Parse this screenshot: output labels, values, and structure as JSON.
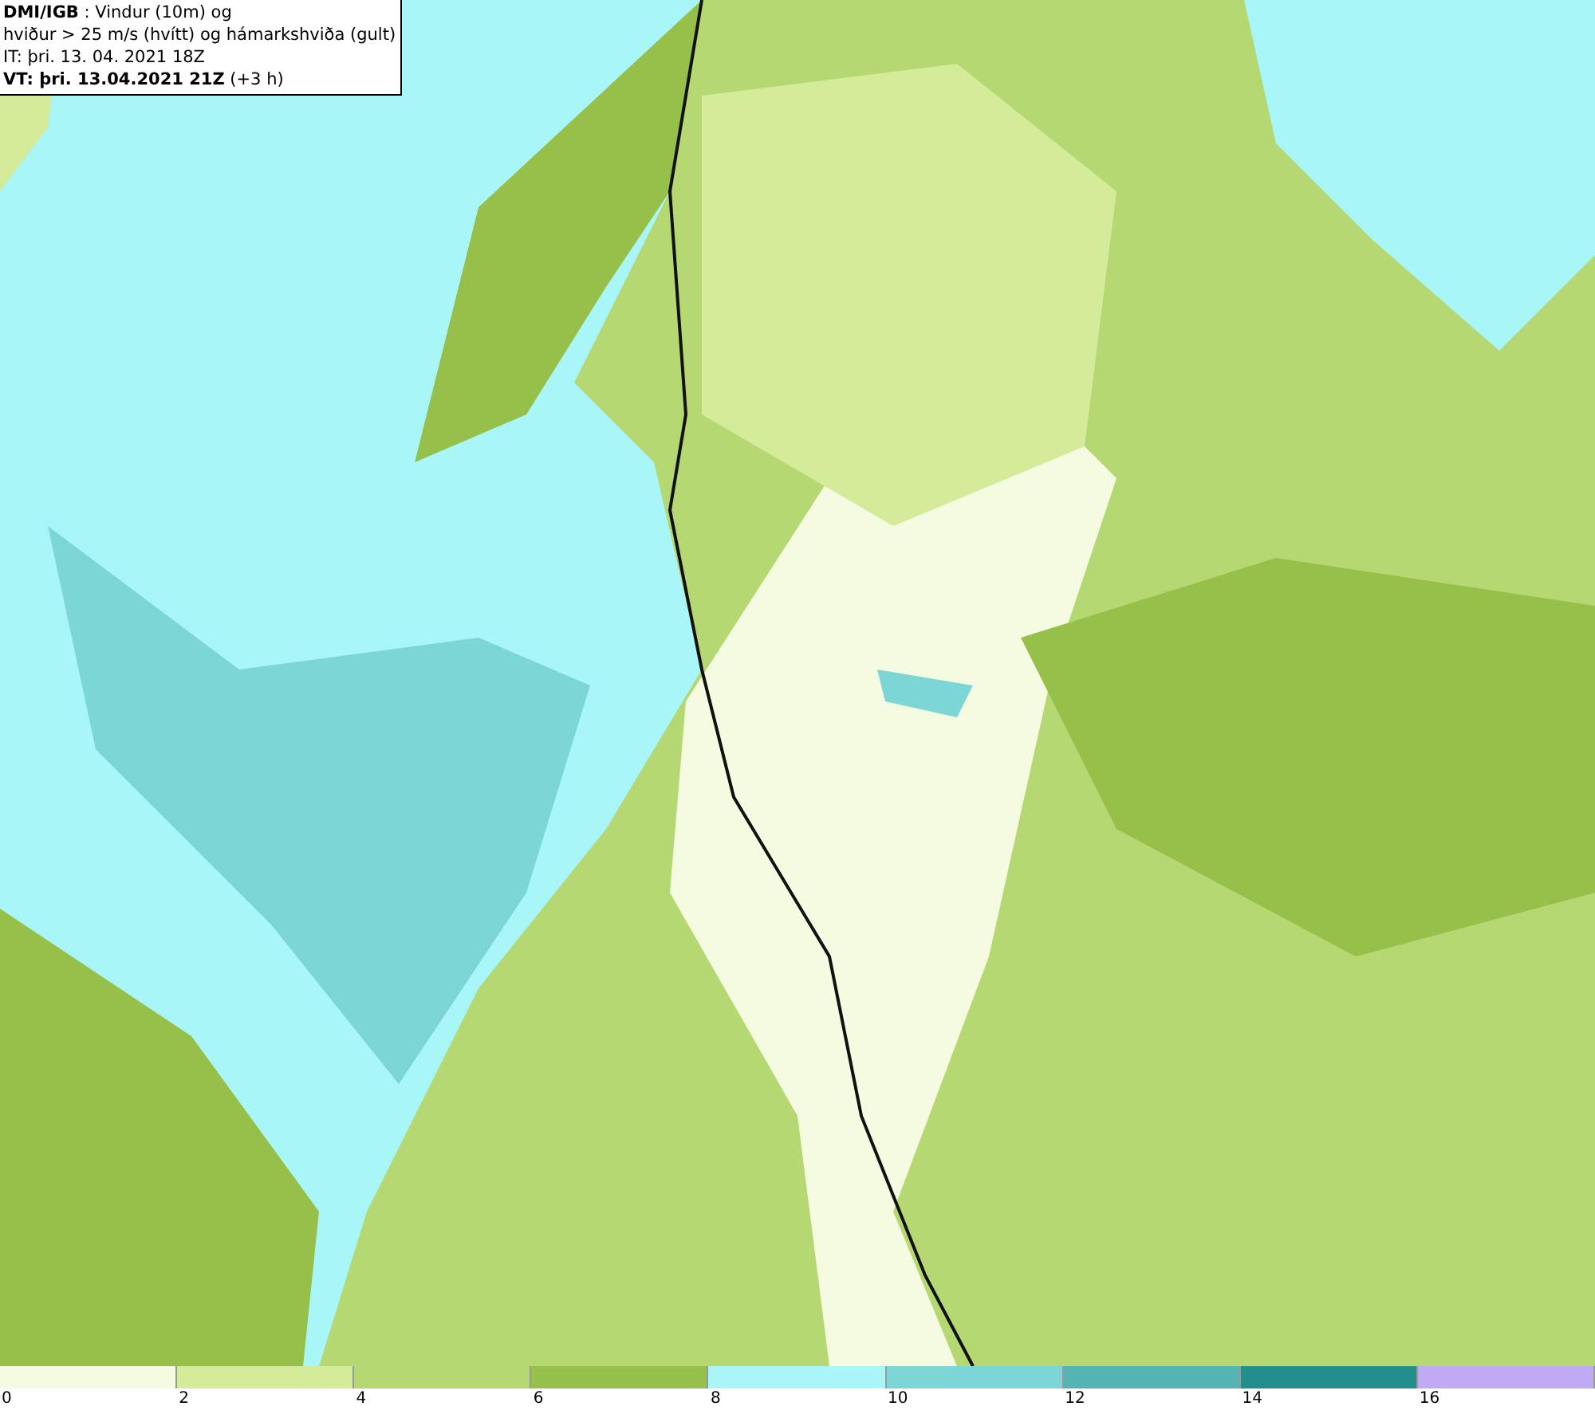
{
  "info_box": {
    "lines": [
      "**DMI/IGB** : Vindur (10m) og",
      "hviður > 25 m/s (hvítt) og hámarkshviða (gult)",
      "IT: þri. 13. 04. 2021 18Z",
      "**VT: þri. 13.04.2021 21Z** (+3 h)"
    ]
  },
  "legend": {
    "items": [
      {
        "label": "0",
        "color": "#f5fbe0"
      },
      {
        "label": "2",
        "color": "#d4eb9a"
      },
      {
        "label": "4",
        "color": "#b5d873"
      },
      {
        "label": "6",
        "color": "#97c04a"
      },
      {
        "label": "8",
        "color": "#a8f6f8"
      },
      {
        "label": "10",
        "color": "#7dd6d6"
      },
      {
        "label": "12",
        "color": "#55b3b3"
      },
      {
        "label": "14",
        "color": "#238f8d"
      },
      {
        "label": "16",
        "color": "#c0aaf6"
      }
    ]
  }
}
